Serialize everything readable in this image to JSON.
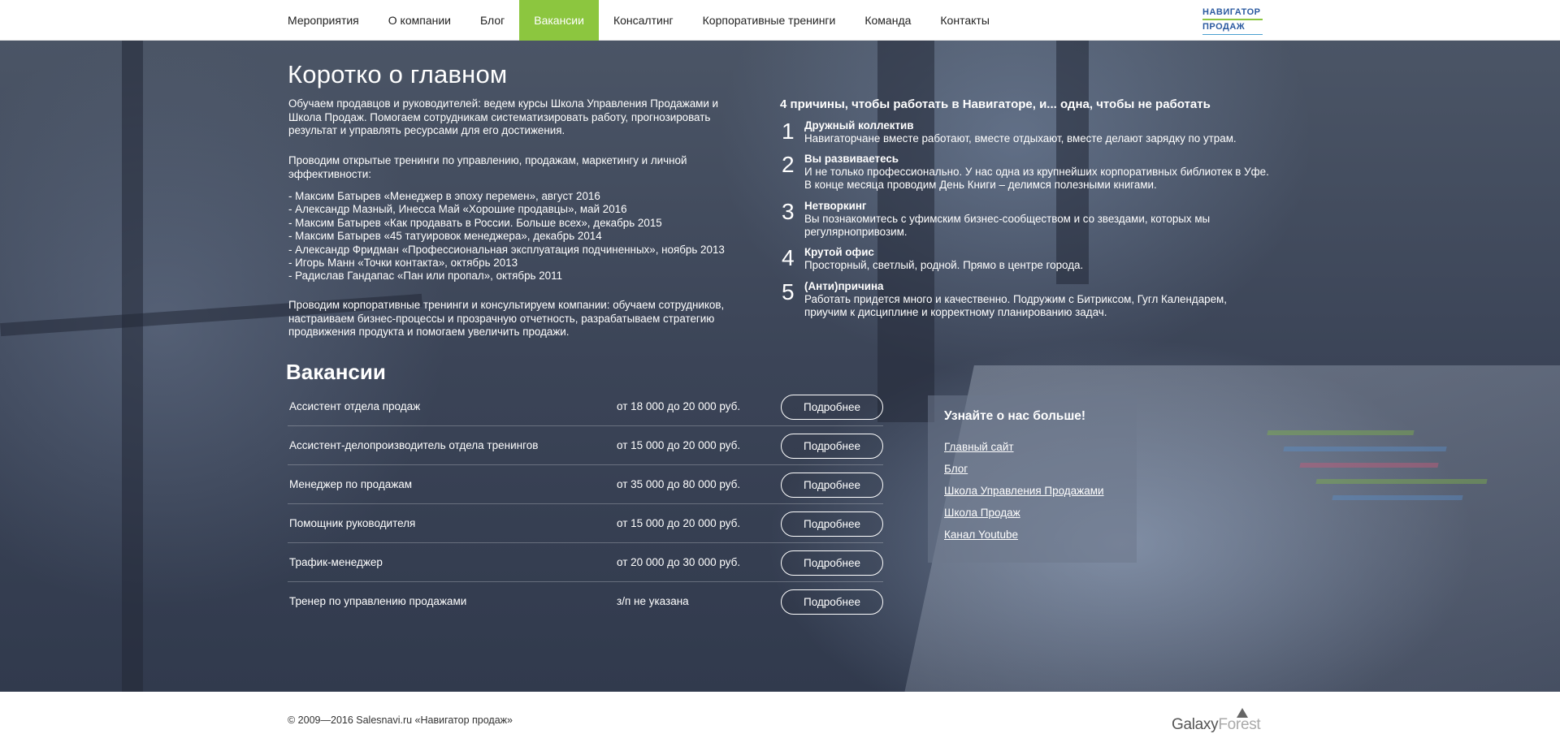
{
  "nav": {
    "items": [
      {
        "label": "Мероприятия",
        "active": false
      },
      {
        "label": "О компании",
        "active": false
      },
      {
        "label": "Блог",
        "active": false
      },
      {
        "label": "Вакансии",
        "active": true
      },
      {
        "label": "Консалтинг",
        "active": false
      },
      {
        "label": "Корпоративные тренинги",
        "active": false
      },
      {
        "label": "Команда",
        "active": false
      },
      {
        "label": "Контакты",
        "active": false
      }
    ],
    "logo_line1": "НАВИГАТОР",
    "logo_line2": "ПРОДАЖ"
  },
  "about": {
    "title": "Коротко о главном",
    "para1": "Обучаем продавцов и руководителей: ведем курсы Школа Управления Продажами и Школа Продаж. Помогаем сотрудникам систематизировать работу, прогнозировать результат и управлять ресурсами для его достижения.",
    "para2": "Проводим открытые тренинги по управлению, продажам, маркетингу и личной эффективности:",
    "events": [
      "- Максим Батырев «Менеджер в эпоху перемен», август 2016",
      "- Александр Мазный, Инесса Май «Хорошие продавцы», май 2016",
      "- Максим Батырев «Как продавать в России. Больше всех», декабрь 2015",
      "- Максим Батырев «45 татуировок менеджера», декабрь 2014",
      "- Александр Фридман «Профессиональная эксплуатация подчиненных», ноябрь 2013",
      "- Игорь Манн «Точки контакта», октябрь 2013",
      "- Радислав Гандапас «Пан или пропал», октябрь 2011"
    ],
    "para3": "Проводим корпоративные тренинги и консультируем компании: обучаем сотрудников, настраиваем бизнес-процессы и прозрачную отчетность, разрабатываем стратегию продвижения продукта и помогаем увеличить продажи."
  },
  "reasons": {
    "title": "4 причины, чтобы работать в Навигаторе, и... одна, чтобы не работать",
    "items": [
      {
        "num": "1",
        "title": "Дружный коллектив",
        "text": "Навигаторчане вместе работают, вместе отдыхают, вместе делают зарядку по утрам."
      },
      {
        "num": "2",
        "title": "Вы развиваетесь",
        "text": "И не только профессионально. У нас одна из крупнейших корпоративных библиотек в Уфе. В конце месяца проводим День Книги – делимся полезными книгами."
      },
      {
        "num": "3",
        "title": "Нетворкинг",
        "text": "Вы познакомитесь с уфимским бизнес-сообществом и со звездами, которых мы регулярнопривозим."
      },
      {
        "num": "4",
        "title": "Крутой офис",
        "text": "Просторный, светлый, родной. Прямо в центре города."
      },
      {
        "num": "5",
        "title": "(Анти)причина",
        "text": "Работать придется много и качественно. Подружим с Битриксом, Гугл Календарем, приучим к дисциплине и корректному планированию задач."
      }
    ]
  },
  "vacancies": {
    "title": "Вакансии",
    "button_label": "Подробнее",
    "items": [
      {
        "name": "Ассистент отдела продаж",
        "salary": "от 18 000 до 20 000 руб."
      },
      {
        "name": "Ассистент-делопроизводитель отдела тренингов",
        "salary": "от 15 000 до 20 000 руб."
      },
      {
        "name": "Менеджер по продажам",
        "salary": "от 35 000 до 80 000 руб."
      },
      {
        "name": "Помощник руководителя",
        "salary": "от 15 000 до 20 000 руб."
      },
      {
        "name": "Трафик-менеджер",
        "salary": "от 20 000 до 30 000 руб."
      },
      {
        "name": "Тренер по управлению продажами",
        "salary": "з/п не указана"
      }
    ]
  },
  "info": {
    "title": "Узнайте о нас больше!",
    "links": [
      "Главный сайт",
      "Блог",
      "Школа Управления Продажами",
      "Школа Продаж",
      "Канал Youtube"
    ]
  },
  "footer": {
    "copyright": "© 2009—2016 Salesnavi.ru «Навигатор продаж»",
    "brand_part1": "Galaxy",
    "brand_part2": "Forest"
  },
  "colors": {
    "accent": "#8cc63f",
    "hero_bg": "#3b4457"
  }
}
